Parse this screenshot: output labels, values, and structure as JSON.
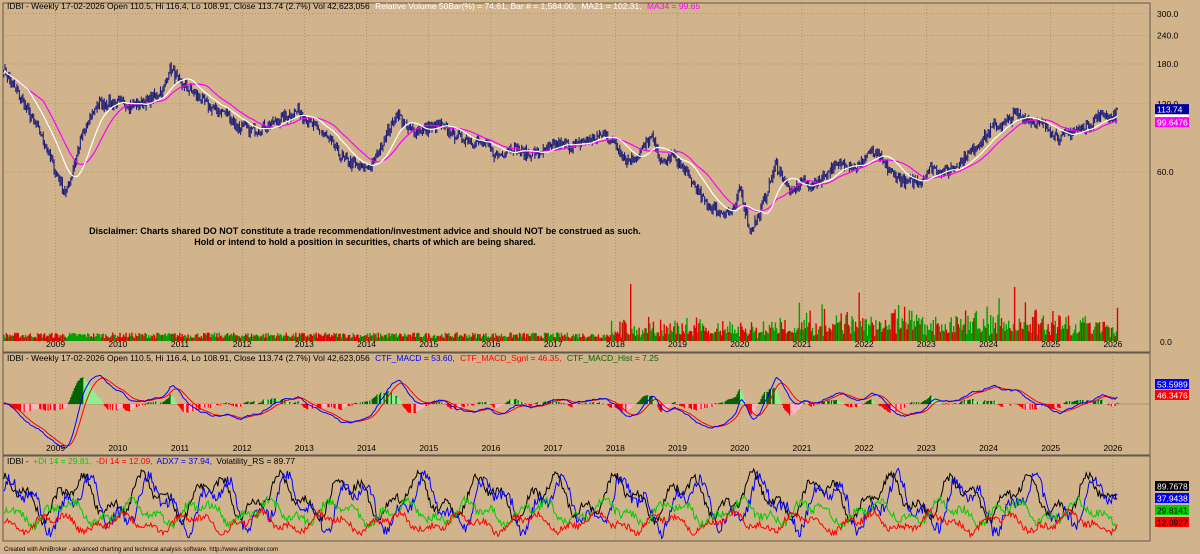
{
  "chart_data": [
    {
      "type": "line",
      "panel": "price",
      "header": {
        "prefix": "IDBI - Weekly 17-02-2026 Open 110.5, Hi 116.4, Lo 108.91, Close 113.74 (2.7%) Vol 42,623,056",
        "relvol": "Relative Volume 50Bar(%) = 74.61, Bar # = 1,584.00,",
        "ma21": "MA21 = 102.31,",
        "ma34": "MA34 = 99.65"
      },
      "scale": "log",
      "y_ticks": [
        {
          "value": 300,
          "label": "300.0"
        },
        {
          "value": 240,
          "label": "240.0"
        },
        {
          "value": 180,
          "label": "180.0"
        },
        {
          "value": 120,
          "label": "120.0"
        },
        {
          "value": 60,
          "label": "60.0"
        }
      ],
      "volume_zero_label": "0.0",
      "last_labels": [
        {
          "text": "113.74",
          "color": "#0000a0",
          "text_color": "#ffffff",
          "value": 113.74
        },
        {
          "text": "102.311",
          "color": "#ffffff",
          "text_color": "#000000",
          "value": 102.311
        },
        {
          "text": "99.6476",
          "color": "#ff00ff",
          "text_color": "#ffffff",
          "value": 99.6476
        }
      ],
      "x_year_labels": [
        "2009",
        "2010",
        "2011",
        "2012",
        "2013",
        "2014",
        "2015",
        "2016",
        "2017",
        "2018",
        "2019",
        "2020",
        "2021",
        "2022",
        "2023",
        "2024",
        "2025",
        "2026"
      ],
      "price_anchors": {
        "date": [
          "2008-03",
          "2008-06",
          "2008-10",
          "2009-01",
          "2009-03",
          "2009-06",
          "2009-09",
          "2010-01",
          "2010-04",
          "2010-07",
          "2010-10",
          "2010-11",
          "2011-01",
          "2011-04",
          "2011-07",
          "2011-10",
          "2011-12",
          "2012-03",
          "2012-06",
          "2012-09",
          "2012-12",
          "2013-02",
          "2013-05",
          "2013-08",
          "2013-10",
          "2013-12",
          "2014-02",
          "2014-05",
          "2014-07",
          "2014-09",
          "2014-12",
          "2015-03",
          "2015-06",
          "2015-09",
          "2015-12",
          "2016-02",
          "2016-05",
          "2016-08",
          "2016-11",
          "2017-02",
          "2017-05",
          "2017-08",
          "2017-11",
          "2018-01",
          "2018-03",
          "2018-05",
          "2018-08",
          "2018-10",
          "2018-12",
          "2019-03",
          "2019-06",
          "2019-09",
          "2019-12",
          "2020-01",
          "2020-03",
          "2020-05",
          "2020-08",
          "2020-11",
          "2021-01",
          "2021-03",
          "2021-06",
          "2021-09",
          "2021-12",
          "2022-02",
          "2022-04",
          "2022-06",
          "2022-09",
          "2022-12",
          "2023-02",
          "2023-05",
          "2023-08",
          "2023-11",
          "2024-02",
          "2024-04",
          "2024-06",
          "2024-09",
          "2024-12",
          "2025-03",
          "2025-05",
          "2025-08",
          "2025-11",
          "2026-01",
          "2026-02"
        ],
        "close": [
          170,
          130,
          90,
          60,
          48,
          85,
          120,
          122,
          118,
          125,
          140,
          175,
          148,
          132,
          115,
          110,
          95,
          92,
          96,
          105,
          112,
          98,
          88,
          70,
          66,
          62,
          64,
          90,
          110,
          92,
          92,
          98,
          87,
          83,
          80,
          70,
          78,
          72,
          74,
          80,
          78,
          84,
          88,
          80,
          68,
          70,
          85,
          65,
          72,
          58,
          45,
          40,
          40,
          52,
          33,
          40,
          65,
          48,
          55,
          52,
          60,
          66,
          63,
          74,
          70,
          60,
          54,
          55,
          63,
          60,
          68,
          80,
          95,
          98,
          108,
          102,
          95,
          85,
          90,
          96,
          108,
          104,
          113.74
        ]
      },
      "volume_peaks": [
        {
          "date": "2018-04",
          "value": 0.6
        },
        {
          "date": "2021-12",
          "value": 0.51
        },
        {
          "date": "2024-06",
          "value": 0.57
        },
        {
          "date": "2024-03",
          "value": 0.45
        }
      ],
      "annotation_line1": "Disclaimer:  Charts shared DO NOT constitute a trade recommendation/investment advice and should NOT be construed as such.",
      "annotation_line2": "Hold or intend to hold a position in securities, charts of which are being shared."
    },
    {
      "type": "line",
      "panel": "macd",
      "header": {
        "prefix": "IDBI - Weekly 17-02-2026 Open 110.5, Hi 116.4, Lo 108.91, Close 113.74 (2.7%) Vol 42,623,056",
        "macd": "CTF_MACD = 53.60,",
        "signal": "CTF_MACD_Sgnl = 46.35,",
        "hist": "CTF_MACD_Hist = 7.25"
      },
      "last_labels": [
        {
          "text": "53.5989",
          "color": "#0000ff",
          "text_color": "#ffffff"
        },
        {
          "text": "46.3476",
          "color": "#ff0000",
          "text_color": "#ffffff"
        }
      ],
      "x_year_labels": [
        "2009",
        "2010",
        "2011",
        "2012",
        "2013",
        "2014",
        "2015",
        "2016",
        "2017",
        "2018",
        "2019",
        "2020",
        "2021",
        "2022",
        "2023",
        "2024",
        "2025",
        "2026"
      ]
    },
    {
      "type": "line",
      "panel": "adx",
      "header": {
        "prefix": "IDBI -",
        "pdi": "+DI 14 = 29.81,",
        "mdi": "-DI 14 = 12.09,",
        "adx": "ADX7 = 37.94,",
        "vol": "Volatility_RS = 89.77"
      },
      "last_labels": [
        {
          "text": "89.7678",
          "color": "#000000",
          "text_color": "#ffffff"
        },
        {
          "text": "37.9438",
          "color": "#0000ff",
          "text_color": "#ffffff"
        },
        {
          "text": "29.8141",
          "color": "#00cc00",
          "text_color": "#000000"
        },
        {
          "text": "12.0927",
          "color": "#ff0000",
          "text_color": "#000000"
        }
      ]
    }
  ],
  "footer": "Created with AmiBroker - advanced charting and technical analysis software. http://www.amibroker.com"
}
